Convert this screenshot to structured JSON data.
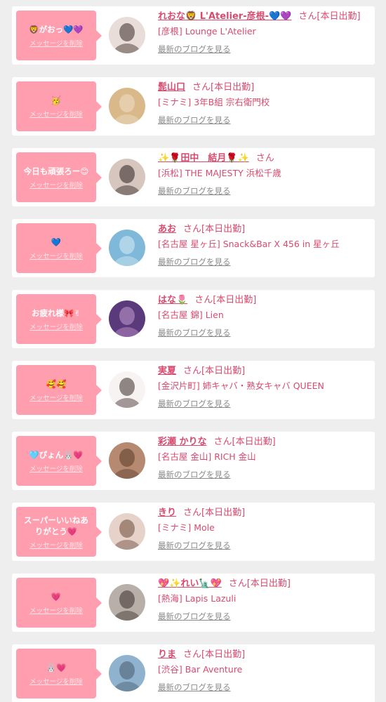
{
  "labels": {
    "delete_message": "メッセージを削除",
    "honorific": "さん",
    "on_duty": "[本日出勤]",
    "latest_blog": "最新のブログを見る"
  },
  "cards": [
    {
      "message": "🦁がおっ💙💜",
      "name": "れおな🦁 L'Atelier-彦根-💙💜",
      "honorific": "さん",
      "status": "[本日出勤]",
      "shop": "[彦根] Lounge L'Atelier",
      "avatar_colors": [
        "#e8ddd8",
        "#3a2a26"
      ]
    },
    {
      "message": "🥳",
      "name": "髭山口",
      "honorific": "さん",
      "status": "[本日出勤]",
      "shop": "[ミナミ] 3年B組 宗右衛門校",
      "avatar_colors": [
        "#d9b98a",
        "#f0e0c8"
      ]
    },
    {
      "message": "今日も頑張ろー😊",
      "name": "✨🌹田中　結月🌹✨",
      "honorific": "さん",
      "status": "",
      "shop": "[浜松] THE MAJESTY 浜松千歳",
      "avatar_colors": [
        "#d7c6bd",
        "#2b2020"
      ]
    },
    {
      "message": "💙",
      "name": "あお",
      "honorific": "さん",
      "status": "[本日出勤]",
      "shop": "[名古屋 星ヶ丘] Snack&Bar X 456 in 星ヶ丘",
      "avatar_colors": [
        "#7fb8d8",
        "#d8ecf5"
      ]
    },
    {
      "message": "お疲れ様🎀✌",
      "name": "はな🌷",
      "honorific": "さん",
      "status": "[本日出勤]",
      "shop": "[名古屋 錦] Lien",
      "avatar_colors": [
        "#5a3a7a",
        "#c79ad0"
      ]
    },
    {
      "message": "🥰🥰",
      "name": "実夏",
      "honorific": "さん",
      "status": "[本日出勤]",
      "shop": "[金沢片町] 姉キャバ・熟女キャバ QUEEN",
      "avatar_colors": [
        "#f7f3f2",
        "#3b2b28"
      ]
    },
    {
      "message": "🩵ぴょん🐰💗",
      "name": "彩瀬 かりな",
      "honorific": "さん",
      "status": "[本日出勤]",
      "shop": "[名古屋 金山] RICH 金山",
      "avatar_colors": [
        "#b58a70",
        "#5a3a2a"
      ]
    },
    {
      "message": "スーパーいいねありがとう💗",
      "name": "きり",
      "honorific": "さん",
      "status": "[本日出勤]",
      "shop": "[ミナミ] Mole",
      "avatar_colors": [
        "#e6d2c8",
        "#6b4a3a"
      ]
    },
    {
      "message": "💗",
      "name": "💖✨れい🗽💖",
      "honorific": "さん",
      "status": "[本日出勤]",
      "shop": "[熱海] Lapis Lazuli",
      "avatar_colors": [
        "#b8b0a8",
        "#3a2e2a"
      ]
    },
    {
      "message": "🐰💗",
      "name": "りま",
      "honorific": "さん",
      "status": "[本日出勤]",
      "shop": "[渋谷] Bar Aventure",
      "avatar_colors": [
        "#8fb3cf",
        "#4a5a6a"
      ]
    }
  ]
}
